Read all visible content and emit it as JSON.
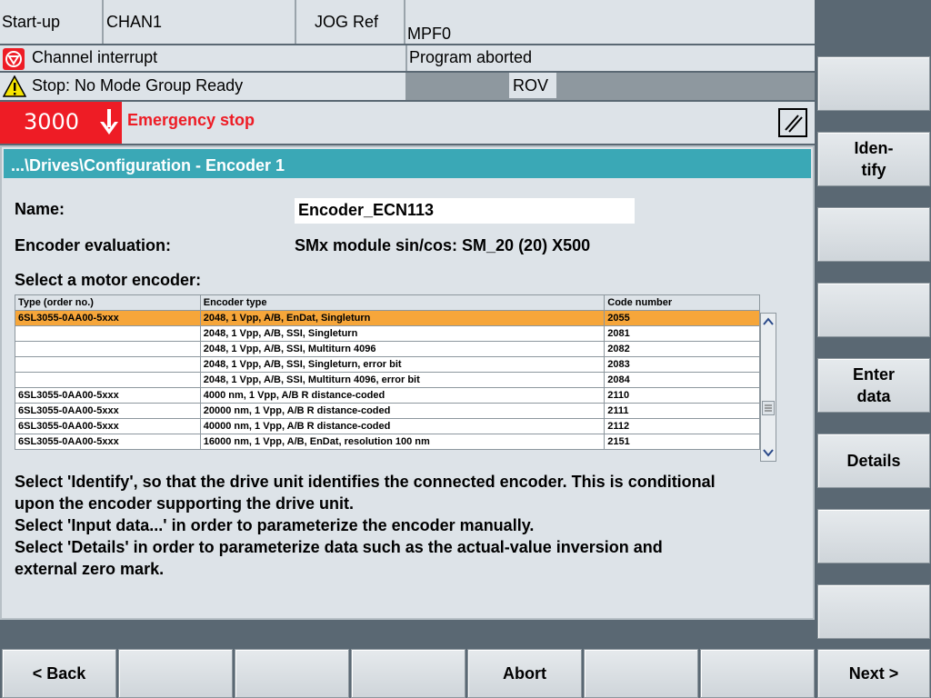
{
  "header": {
    "area": "Start-up",
    "channel": "CHAN1",
    "mode": "JOG Ref",
    "program": "MPF0",
    "channel_status": "Channel interrupt",
    "program_status": "Program aborted",
    "stop_message": "Stop: No Mode Group Ready",
    "rov": "ROV",
    "alarm_number": "3000",
    "alarm_text": "Emergency stop"
  },
  "window": {
    "title": "...\\Drives\\Configuration - Encoder 1",
    "name_label": "Name:",
    "name_value": "Encoder_ECN113",
    "evaluation_label": "Encoder evaluation:",
    "evaluation_value": "SMx module sin/cos: SM_20 (20) X500",
    "select_label": "Select a motor encoder:"
  },
  "encoder_table": {
    "columns": [
      "Type (order no.)",
      "Encoder type",
      "Code number"
    ],
    "rows": [
      [
        "6SL3055-0AA00-5xxx",
        "2048, 1 Vpp, A/B, EnDat, Singleturn",
        "2055"
      ],
      [
        "",
        "2048, 1 Vpp, A/B, SSI, Singleturn",
        "2081"
      ],
      [
        "",
        "2048, 1 Vpp, A/B, SSI, Multiturn 4096",
        "2082"
      ],
      [
        "",
        "2048, 1 Vpp, A/B, SSI, Singleturn, error bit",
        "2083"
      ],
      [
        "",
        "2048, 1 Vpp, A/B, SSI, Multiturn 4096, error bit",
        "2084"
      ],
      [
        "6SL3055-0AA00-5xxx",
        "4000 nm, 1 Vpp, A/B R distance-coded",
        "2110"
      ],
      [
        "6SL3055-0AA00-5xxx",
        "20000 nm, 1 Vpp, A/B R distance-coded",
        "2111"
      ],
      [
        "6SL3055-0AA00-5xxx",
        "40000 nm, 1 Vpp, A/B R distance-coded",
        "2112"
      ],
      [
        "6SL3055-0AA00-5xxx",
        "16000 nm, 1 Vpp, A/B, EnDat, resolution 100 nm",
        "2151"
      ]
    ],
    "selected_row": 0
  },
  "help_text": [
    "Select 'Identify', so that the drive unit identifies the connected encoder. This is conditional",
    "upon the encoder supporting the drive unit.",
    "Select 'Input data...' in order to parameterize the encoder manually.",
    "Select 'Details' in order to parameterize data such as the actual-value inversion and",
    "external zero mark."
  ],
  "vertical_softkeys": [
    "",
    "Iden-\ntify",
    "",
    "",
    "Enter\ndata",
    "Details",
    "",
    ""
  ],
  "horizontal_softkeys": [
    "< Back",
    "",
    "",
    "",
    "Abort",
    "",
    "",
    "Next >"
  ],
  "colors": {
    "alarm_red": "#ee1c25",
    "title_bar": "#3aa8b6",
    "selected_row": "#f6a63a"
  }
}
